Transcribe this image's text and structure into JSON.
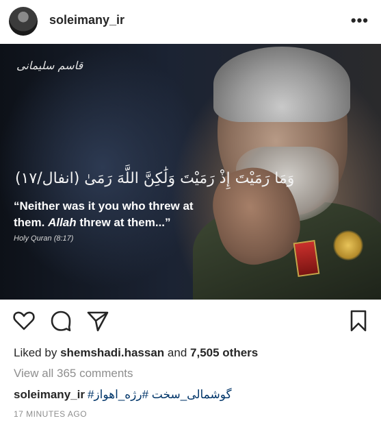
{
  "post": {
    "username": "soleimany_ir",
    "more_label": "•••",
    "image": {
      "signature": "قاسم سلیمانی",
      "arabic_verse": "وَمَا رَمَيْتَ إِذْ رَمَيْتَ وَلَٰكِنَّ اللَّهَ رَمَىٰ (انفال/١٧)",
      "quote_line1": "“Neither was it you who threw at",
      "quote_line2_pre": "them. ",
      "quote_line2_allah": "Allah",
      "quote_line2_post": " threw at them...”",
      "source": "Holy Quran (8:17)"
    },
    "likes": {
      "prefix": "Liked by",
      "user": "shemshadi.hassan",
      "middle": "and",
      "others": "7,505 others"
    },
    "view_comments": "View all 365 comments",
    "caption": {
      "user": "soleimany_ir",
      "tags": "#گوشمالی_سخت #رژه_اهواز"
    },
    "timestamp": "17 MINUTES AGO"
  },
  "icons": {
    "heart": "heart-icon",
    "comment": "comment-icon",
    "share": "share-icon",
    "save": "bookmark-icon"
  },
  "colors": {
    "text": "#262626",
    "muted": "#8e8e8e",
    "hashtag": "#003569"
  }
}
